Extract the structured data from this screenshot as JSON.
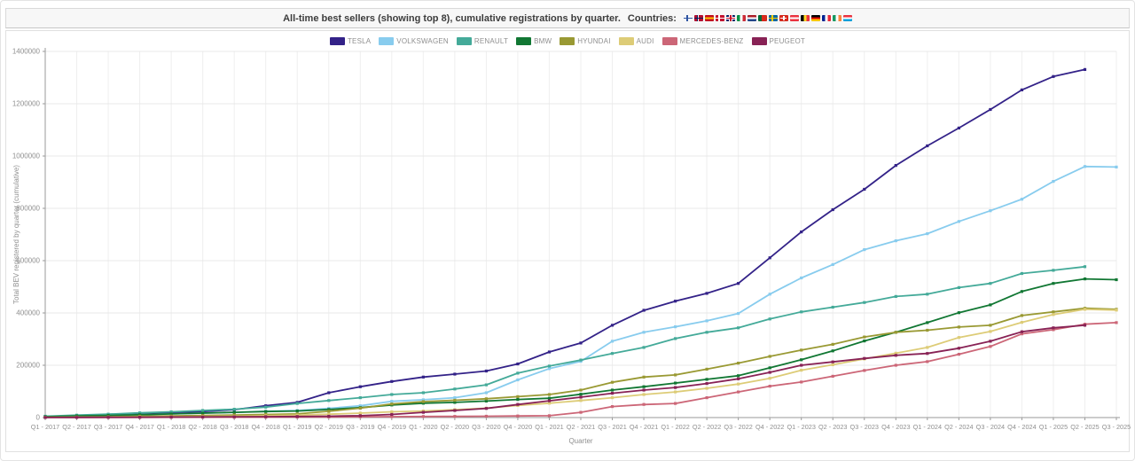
{
  "header": {
    "title": "All-time best sellers (showing top 8), cumulative registrations by quarter.",
    "countries_label": "Countries:",
    "flags": [
      {
        "name": "finland-flag",
        "type": "nordic",
        "colors": [
          "#ffffff",
          "#2d53a0"
        ]
      },
      {
        "name": "norway-flag",
        "type": "nordic",
        "colors": [
          "#ba0c2f",
          "#ffffff",
          "#00205b"
        ]
      },
      {
        "name": "spain-flag",
        "type": "h",
        "colors": [
          "#c60b1e",
          "#ffc400",
          "#c60b1e"
        ]
      },
      {
        "name": "denmark-flag",
        "type": "nordic",
        "colors": [
          "#c8102e",
          "#ffffff"
        ]
      },
      {
        "name": "united-kingdom-flag",
        "type": "uk",
        "colors": [
          "#012169",
          "#ffffff",
          "#c8102e"
        ]
      },
      {
        "name": "italy-flag",
        "type": "v",
        "colors": [
          "#009246",
          "#ffffff",
          "#ce2b37"
        ]
      },
      {
        "name": "netherlands-flag",
        "type": "h",
        "colors": [
          "#ae1c28",
          "#ffffff",
          "#21468b"
        ]
      },
      {
        "name": "portugal-flag",
        "type": "v2",
        "colors": [
          "#046a38",
          "#da291c"
        ]
      },
      {
        "name": "sweden-flag",
        "type": "nordic",
        "colors": [
          "#006aa7",
          "#fecc02"
        ]
      },
      {
        "name": "switzerland-flag",
        "type": "plus",
        "colors": [
          "#da291c",
          "#ffffff"
        ]
      },
      {
        "name": "austria-flag",
        "type": "h",
        "colors": [
          "#ef3340",
          "#ffffff",
          "#ef3340"
        ]
      },
      {
        "name": "belgium-flag",
        "type": "v",
        "colors": [
          "#000000",
          "#fdda24",
          "#ef3340"
        ]
      },
      {
        "name": "germany-flag",
        "type": "h",
        "colors": [
          "#000000",
          "#dd0000",
          "#ffcc00"
        ]
      },
      {
        "name": "france-flag",
        "type": "v",
        "colors": [
          "#002395",
          "#ffffff",
          "#ed2939"
        ]
      },
      {
        "name": "ireland-flag",
        "type": "v",
        "colors": [
          "#169b62",
          "#ffffff",
          "#ff883e"
        ]
      },
      {
        "name": "luxembourg-flag",
        "type": "h",
        "colors": [
          "#ef3340",
          "#ffffff",
          "#00a3e0"
        ]
      }
    ]
  },
  "chart_data": {
    "type": "line",
    "title": "All-time best sellers (showing top 8), cumulative registrations by quarter.",
    "xlabel": "Quarter",
    "ylabel": "Total BEV registered by quarter (cumulative)",
    "ylim": [
      0,
      1400000
    ],
    "y_ticks": [
      0,
      200000,
      400000,
      600000,
      800000,
      1000000,
      1200000,
      1400000
    ],
    "grid": true,
    "legend_position": "top-center",
    "x_categories": [
      "Q1 - 2017",
      "Q2 - 2017",
      "Q3 - 2017",
      "Q4 - 2017",
      "Q1 - 2018",
      "Q2 - 2018",
      "Q3 - 2018",
      "Q4 - 2018",
      "Q1 - 2019",
      "Q2 - 2019",
      "Q3 - 2019",
      "Q4 - 2019",
      "Q1 - 2020",
      "Q2 - 2020",
      "Q3 - 2020",
      "Q4 - 2020",
      "Q1 - 2021",
      "Q2 - 2021",
      "Q3 - 2021",
      "Q4 - 2021",
      "Q1 - 2022",
      "Q2 - 2022",
      "Q3 - 2022",
      "Q4 - 2022",
      "Q1 - 2023",
      "Q2 - 2023",
      "Q3 - 2023",
      "Q4 - 2023",
      "Q1 - 2024",
      "Q2 - 2024",
      "Q3 - 2024",
      "Q4 - 2024",
      "Q1 - 2025",
      "Q2 - 2025",
      "Q3 - 2025"
    ],
    "series": [
      {
        "name": "TESLA",
        "color": "#332288",
        "values": [
          4000,
          7000,
          10000,
          14000,
          18000,
          23000,
          30000,
          45000,
          58000,
          95000,
          118000,
          138000,
          155000,
          166000,
          178000,
          205000,
          251000,
          285000,
          353000,
          410000,
          445000,
          475000,
          513000,
          611000,
          710000,
          795000,
          873000,
          964000,
          1039000,
          1107000,
          1178000,
          1253000,
          1304000,
          1331000,
          null
        ]
      },
      {
        "name": "VOLKSWAGEN",
        "color": "#88ccee",
        "values": [
          3000,
          5000,
          8000,
          11000,
          14000,
          17000,
          20000,
          24000,
          27000,
          35000,
          45000,
          62000,
          68000,
          76000,
          95000,
          144000,
          187000,
          215000,
          292000,
          326000,
          347000,
          370000,
          398000,
          472000,
          534000,
          585000,
          642000,
          676000,
          703000,
          750000,
          791000,
          835000,
          903000,
          960000,
          958000
        ]
      },
      {
        "name": "RENAULT",
        "color": "#44aa99",
        "values": [
          5000,
          9000,
          13000,
          18000,
          22000,
          27000,
          32000,
          40000,
          54000,
          65000,
          76000,
          88000,
          95000,
          109000,
          125000,
          170000,
          197000,
          220000,
          245000,
          268000,
          302000,
          326000,
          343000,
          377000,
          404000,
          422000,
          440000,
          463000,
          472000,
          497000,
          513000,
          551000,
          563000,
          577000,
          null
        ]
      },
      {
        "name": "BMW",
        "color": "#117733",
        "values": [
          3000,
          6000,
          8000,
          11000,
          14000,
          17000,
          20000,
          23000,
          25000,
          31000,
          38000,
          48000,
          55000,
          58000,
          63000,
          69000,
          74000,
          89000,
          105000,
          118000,
          132000,
          146000,
          160000,
          190000,
          221000,
          255000,
          293000,
          326000,
          363000,
          401000,
          431000,
          482000,
          513000,
          530000,
          527000
        ]
      },
      {
        "name": "HYUNDAI",
        "color": "#999933",
        "values": [
          1000,
          2000,
          3000,
          5000,
          6000,
          8000,
          10000,
          12000,
          14000,
          24000,
          36000,
          52000,
          61000,
          66000,
          72000,
          80000,
          88000,
          105000,
          135000,
          155000,
          163000,
          185000,
          208000,
          234000,
          258000,
          280000,
          308000,
          326000,
          334000,
          346000,
          353000,
          390000,
          404000,
          418000,
          414000
        ]
      },
      {
        "name": "AUDI",
        "color": "#ddcc77",
        "values": [
          500,
          1000,
          1500,
          2000,
          3000,
          4000,
          5000,
          7000,
          9000,
          13000,
          17000,
          22000,
          25000,
          30000,
          36000,
          46000,
          55000,
          65000,
          76000,
          88000,
          98000,
          112000,
          128000,
          150000,
          181000,
          202000,
          224000,
          246000,
          268000,
          306000,
          329000,
          364000,
          394000,
          414000,
          411000
        ]
      },
      {
        "name": "MERCEDES-BENZ",
        "color": "#cc6677",
        "values": [
          200,
          400,
          600,
          800,
          1000,
          1200,
          1500,
          1800,
          2000,
          2500,
          3000,
          3500,
          4000,
          4500,
          5000,
          6000,
          7000,
          20000,
          42000,
          50000,
          54000,
          76000,
          98000,
          120000,
          136000,
          158000,
          180000,
          200000,
          214000,
          242000,
          272000,
          320000,
          336000,
          357000,
          363000
        ]
      },
      {
        "name": "PEUGEOT",
        "color": "#882255",
        "values": [
          300,
          600,
          1000,
          1500,
          2000,
          2500,
          3000,
          3500,
          4000,
          5000,
          7000,
          12000,
          20000,
          27000,
          35000,
          50000,
          64000,
          78000,
          93000,
          105000,
          115000,
          130000,
          148000,
          173000,
          200000,
          213000,
          226000,
          238000,
          245000,
          265000,
          292000,
          328000,
          343000,
          353000,
          null
        ]
      }
    ]
  }
}
